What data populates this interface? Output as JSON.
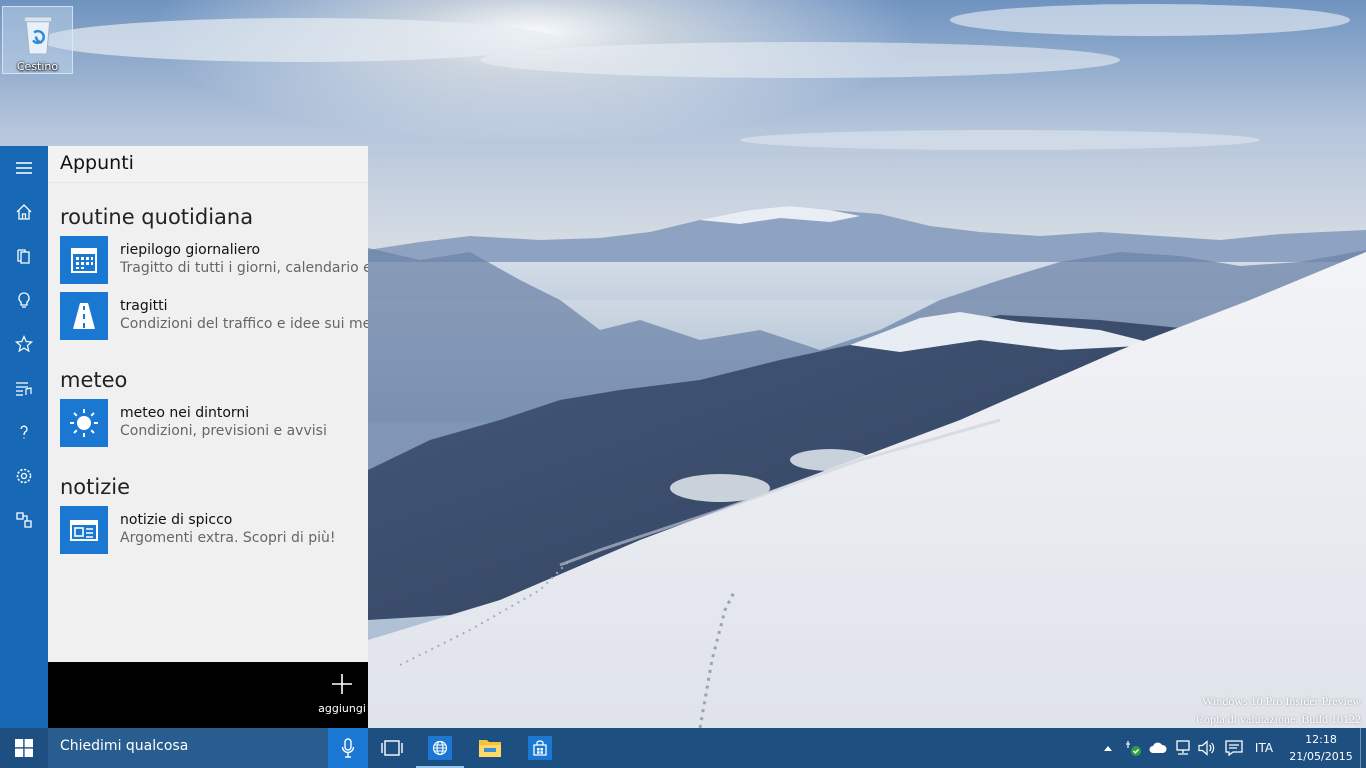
{
  "desktop": {
    "recycle_bin_label": "Cestino",
    "watermark_line1": "Windows 10 Pro Insider Preview",
    "watermark_line2": "Copia di valutazione. Build 10122"
  },
  "cortana": {
    "rail_icons": [
      "hamburger-menu-icon",
      "home-icon",
      "notebook-icon",
      "lightbulb-icon",
      "star-icon",
      "music-list-icon",
      "help-icon",
      "settings-icon",
      "feedback-icon"
    ],
    "header_title": "Appunti",
    "sections": [
      {
        "title": "routine quotidiana",
        "cards": [
          {
            "icon": "calendar-icon",
            "title": "riepilogo giornaliero",
            "subtitle": "Tragitto di tutti i giorni, calendario e a"
          },
          {
            "icon": "road-icon",
            "title": "tragitti",
            "subtitle": "Condizioni del traffico e idee sui mezz"
          }
        ]
      },
      {
        "title": "meteo",
        "cards": [
          {
            "icon": "sun-icon",
            "title": "meteo nei dintorni",
            "subtitle": "Condizioni, previsioni e avvisi"
          }
        ]
      },
      {
        "title": "notizie",
        "cards": [
          {
            "icon": "newspaper-icon",
            "title": "notizie di spicco",
            "subtitle": "Argomenti extra. Scopri di più!"
          }
        ]
      }
    ],
    "add_label": "aggiungi"
  },
  "taskbar": {
    "search_placeholder": "Chiedimi qualcosa",
    "pinned_icons": [
      "task-view-icon",
      "browser-icon",
      "file-explorer-icon",
      "store-icon"
    ],
    "tray": {
      "language": "ITA",
      "time": "12:18",
      "date": "21/05/2015"
    }
  },
  "colors": {
    "accent": "#1a78d2",
    "rail": "#1769b6",
    "taskbar": "#1d4f80"
  }
}
